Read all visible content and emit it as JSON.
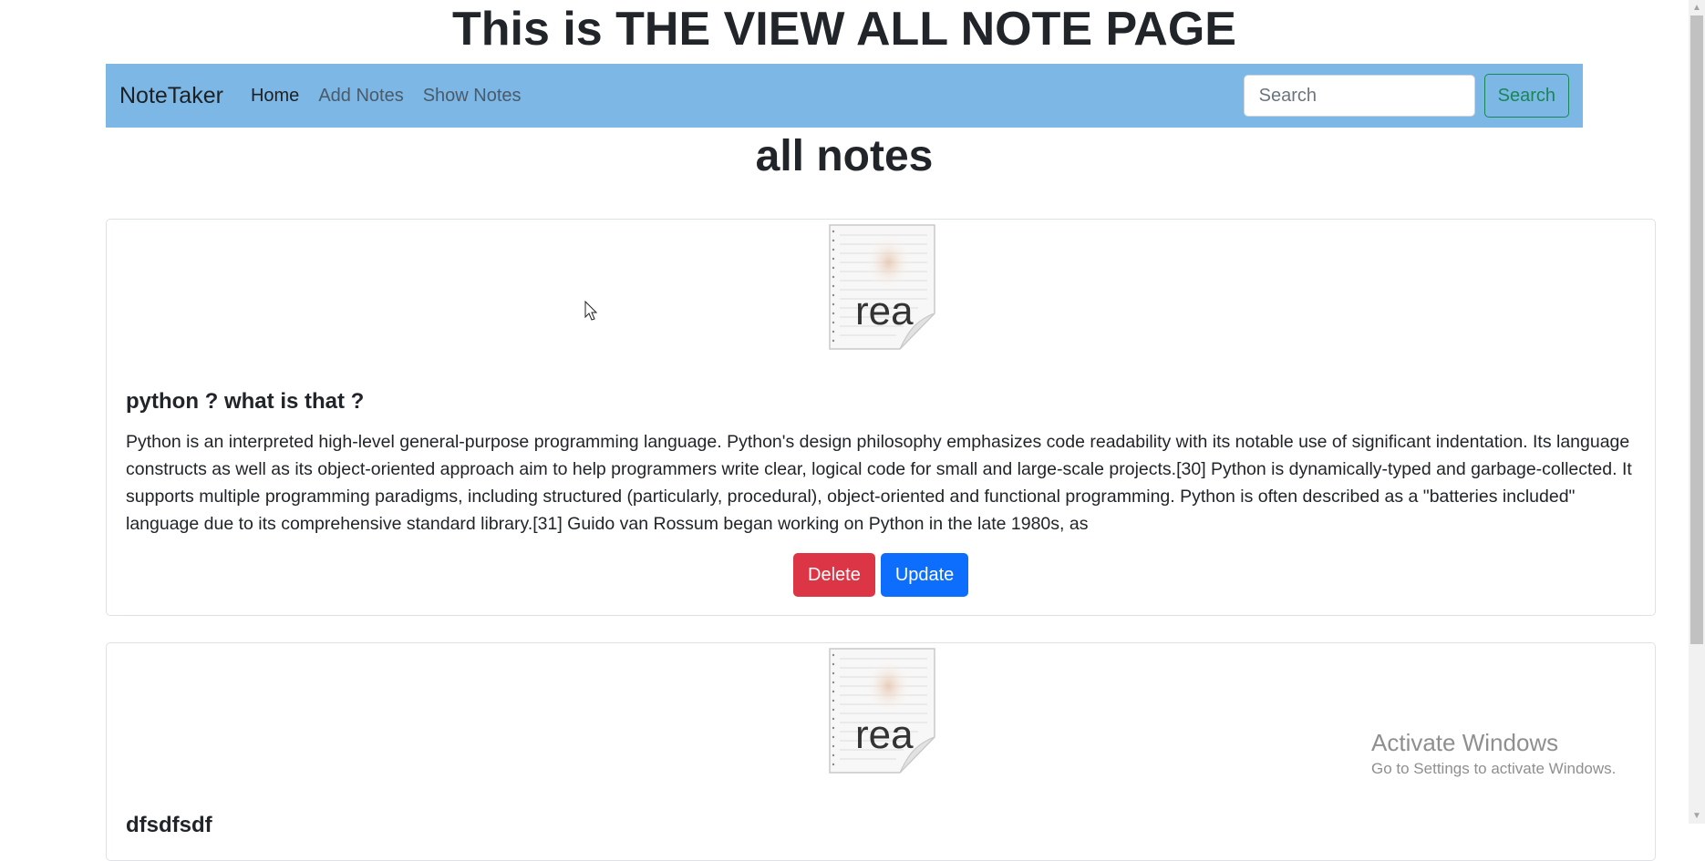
{
  "page": {
    "heading": "This is THE VIEW ALL NOTE PAGE"
  },
  "navbar": {
    "brand": "NoteTaker",
    "links": [
      {
        "label": "Home",
        "active": true
      },
      {
        "label": "Add Notes",
        "active": false
      },
      {
        "label": "Show Notes",
        "active": false
      }
    ],
    "search": {
      "placeholder": "Search",
      "value": "",
      "button_label": "Search"
    }
  },
  "notes_section": {
    "title": "all notes"
  },
  "notes": [
    {
      "thumbnail_text": "rea",
      "title": "python ? what is that ?",
      "content": "Python is an interpreted high-level general-purpose programming language. Python's design philosophy emphasizes code readability with its notable use of significant indentation. Its language constructs as well as its object-oriented approach aim to help programmers write clear, logical code for small and large-scale projects.[30] Python is dynamically-typed and garbage-collected. It supports multiple programming paradigms, including structured (particularly, procedural), object-oriented and functional programming. Python is often described as a \"batteries included\" language due to its comprehensive standard library.[31] Guido van Rossum began working on Python in the late 1980s, as",
      "delete_label": "Delete",
      "update_label": "Update"
    },
    {
      "thumbnail_text": "rea",
      "title": "dfsdfsdf"
    }
  ],
  "watermark": {
    "title": "Activate Windows",
    "subtitle": "Go to Settings to activate Windows."
  },
  "colors": {
    "navbar_bg": "#7cb7e6",
    "delete": "#dc3545",
    "update": "#0d6efd",
    "search_outline": "#198754"
  },
  "icons": {
    "note_thumbnail": "readme-document-icon",
    "cursor": "mouse-pointer-icon",
    "scroll_up": "chevron-up-icon",
    "scroll_down": "chevron-down-icon"
  }
}
